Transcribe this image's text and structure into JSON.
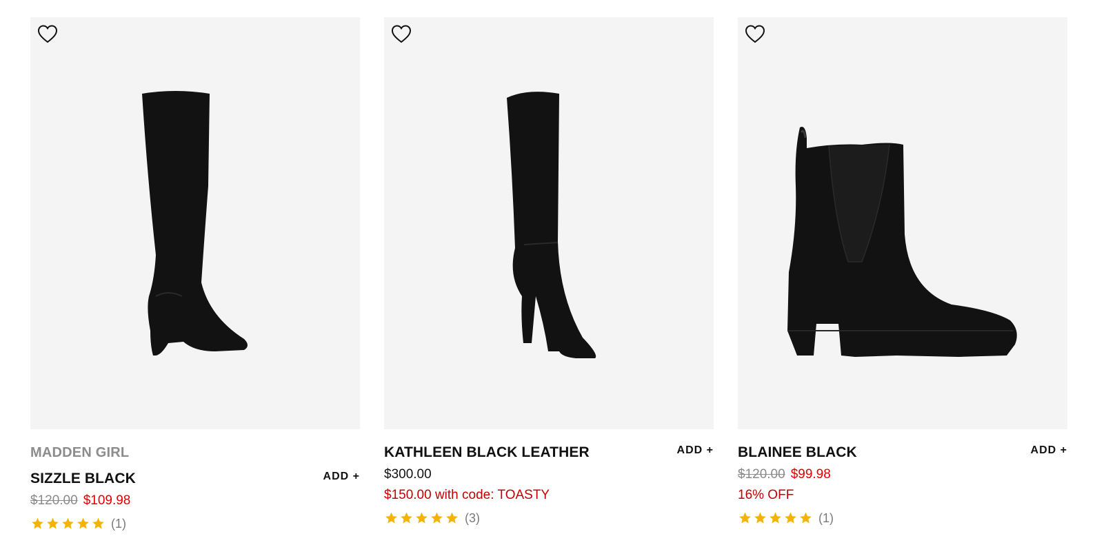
{
  "colors": {
    "image_bg": "#f4f4f4",
    "sale": "#e00000",
    "promo": "#c00000",
    "star": "#f5b301",
    "muted": "#8a8a8a"
  },
  "products": [
    {
      "brand": "MADDEN GIRL",
      "name": "SIZZLE BLACK",
      "add_label": "ADD +",
      "price_original": "$120.00",
      "price_sale": "$109.98",
      "rating_stars": 5,
      "review_count": "(1)",
      "wishlist_icon": "heart-outline-icon"
    },
    {
      "name": "KATHLEEN BLACK LEATHER",
      "add_label": "ADD +",
      "price_regular": "$300.00",
      "promo": "$150.00 with code: TOASTY",
      "rating_stars": 5,
      "review_count": "(3)",
      "wishlist_icon": "heart-outline-icon"
    },
    {
      "name": "BLAINEE BLACK",
      "add_label": "ADD +",
      "price_original": "$120.00",
      "price_sale": "$99.98",
      "promo": "16% OFF",
      "rating_stars": 5,
      "review_count": "(1)",
      "wishlist_icon": "heart-outline-icon"
    }
  ]
}
